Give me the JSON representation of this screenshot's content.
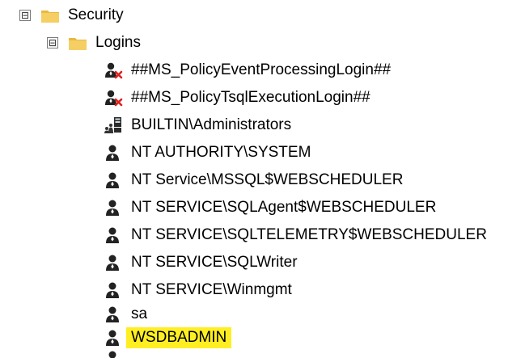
{
  "tree": {
    "security": {
      "label": "Security",
      "expander": "⊟"
    },
    "logins": {
      "label": "Logins",
      "expander": "⊟"
    },
    "items": [
      {
        "label": "##MS_PolicyEventProcessingLogin##",
        "icon": "login-disabled-icon"
      },
      {
        "label": "##MS_PolicyTsqlExecutionLogin##",
        "icon": "login-disabled-icon"
      },
      {
        "label": "BUILTIN\\Administrators",
        "icon": "windows-group-icon"
      },
      {
        "label": "NT AUTHORITY\\SYSTEM",
        "icon": "user-login-icon"
      },
      {
        "label": "NT Service\\MSSQL$WEBSCHEDULER",
        "icon": "user-login-icon"
      },
      {
        "label": "NT SERVICE\\SQLAgent$WEBSCHEDULER",
        "icon": "user-login-icon"
      },
      {
        "label": "NT SERVICE\\SQLTELEMETRY$WEBSCHEDULER",
        "icon": "user-login-icon"
      },
      {
        "label": "NT SERVICE\\SQLWriter",
        "icon": "user-login-icon"
      },
      {
        "label": "NT SERVICE\\Winmgmt",
        "icon": "user-login-icon"
      },
      {
        "label": "sa",
        "icon": "user-login-icon"
      },
      {
        "label": "WSDBADMIN",
        "icon": "user-login-icon",
        "highlighted": true
      }
    ]
  },
  "colors": {
    "highlight": "#ffef22",
    "folder": "#f0c040",
    "disabled_mark": "#e02020"
  }
}
